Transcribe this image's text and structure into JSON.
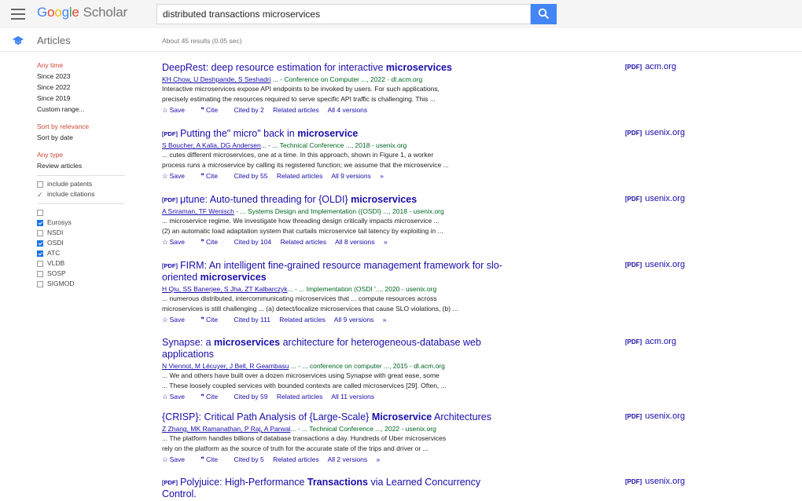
{
  "header": {
    "logo_parts": [
      "G",
      "o",
      "o",
      "g",
      "l",
      "e"
    ],
    "logo_suffix": "Scholar",
    "search_value": "distributed transactions microservices"
  },
  "subheader": {
    "section_label": "Articles",
    "results_count": "About 45 results (0.05 sec)"
  },
  "sidebar": {
    "time_links": [
      "Any time",
      "Since 2023",
      "Since 2022",
      "Since 2019",
      "Custom range..."
    ],
    "sort_links": [
      "Sort by relevance",
      "Sort by date"
    ],
    "type_links": [
      "Any type",
      "Review articles"
    ],
    "include_patents": "include patents",
    "include_citations": "include citations",
    "venues": [
      {
        "label": "",
        "checked": false
      },
      {
        "label": "Eurosys",
        "checked": true
      },
      {
        "label": "NSDI",
        "checked": false
      },
      {
        "label": "OSDI",
        "checked": true
      },
      {
        "label": "ATC",
        "checked": true
      },
      {
        "label": "VLDB",
        "checked": false
      },
      {
        "label": "SOSP",
        "checked": false
      },
      {
        "label": "SIGMOD",
        "checked": false
      }
    ]
  },
  "results": [
    {
      "title_a": "DeepRest: deep resource estimation for interactive ",
      "title_b": "microservices",
      "authors": "KH Chow, U Deshpande, S Seshadri",
      "venue": " ... - Conference on Computer ..., 2022 - dl.acm.org",
      "snippet1": "Interactive microservices expose API endpoints to be invoked by users. For such applications,",
      "snippet2": "precisely estimating the resources required to serve specific API traffic is challenging. This ...",
      "save": "Save",
      "cite": "Cite",
      "cited_by": "Cited by 2",
      "related": "Related articles",
      "versions": "All 4 versions",
      "side_tag": "[PDF]",
      "side_source": "acm.org"
    },
    {
      "pdf": "[PDF]",
      "title_a": "Putting the\" micro\" back in ",
      "title_b": "microservice",
      "authors": "S Boucher, A Kalia, DG Andersen",
      "venue": "... - ... Technical Conference ..., 2018 - usenix.org",
      "snippet1": "... cutes different microservices, one at a time. In this approach, shown in Figure 1, a worker",
      "snippet2": "process runs a microservice by calling its registered function; we assume that the microservice ...",
      "save": "Save",
      "cite": "Cite",
      "cited_by": "Cited by 55",
      "related": "Related articles",
      "versions": "All 9 versions",
      "side_tag": "[PDF]",
      "side_source": "usenix.org"
    },
    {
      "pdf": "[PDF]",
      "title_a": "μtune: Auto-tuned threading for {OLDI} ",
      "title_b": "microservices",
      "authors": "A Sriraman, TF Wenisch",
      "venue": " - ... Systems Design and Implementation ({OSDI} ..., 2018 - usenix.org",
      "snippet1": "... microservice regime. We investigate how threading design critically impacts microservice ...",
      "snippet2": "(2) an automatic load adaptation system that curtails microservice tail latency by exploiting in ...",
      "save": "Save",
      "cite": "Cite",
      "cited_by": "Cited by 104",
      "related": "Related articles",
      "versions": "All 8 versions",
      "side_tag": "[PDF]",
      "side_source": "usenix.org"
    },
    {
      "pdf": "[PDF]",
      "title_a": "FIRM: An intelligent fine-grained resource management framework for slo-",
      "title_b2": "oriented ",
      "title_c": "microservices",
      "authors": "H Qiu, SS Banerjee, S Jha, ZT Kalbarczyk",
      "venue": "... - ... Implementation (OSDI '..., 2020 - usenix.org",
      "snippet1": "... numerous distributed, intercommunicating microservices that ... compute resources across",
      "snippet2": "microservices is still challenging ... (a) detect/localize microservices that cause SLO violations, (b) ...",
      "save": "Save",
      "cite": "Cite",
      "cited_by": "Cited by 111",
      "related": "Related articles",
      "versions": "All 9 versions",
      "side_tag": "[PDF]",
      "side_source": "usenix.org"
    },
    {
      "title_a": "Synapse: a ",
      "title_b": "microservices",
      "title_c": " architecture for heterogeneous-database web",
      "title_d": "applications",
      "authors": "N Viennot, M Lécuyer, J Bell, R Geambasu",
      "venue": " ... - ... conference on computer ..., 2015 - dl.acm.org",
      "snippet1": "... We and others have built over a dozen microservices using Synapse with great ease, some",
      "snippet2": "... These loosely coupled services with bounded contexts are called microservices [29]. Often, ...",
      "save": "Save",
      "cite": "Cite",
      "cited_by": "Cited by 59",
      "related": "Related articles",
      "versions": "All 11 versions",
      "side_tag": "[PDF]",
      "side_source": "acm.org"
    },
    {
      "title_a": "{CRISP}: Critical Path Analysis of {Large-Scale} ",
      "title_b": "Microservice",
      "title_c": " Architectures",
      "authors": "Z Zhang, MK Ramanathan, P Raj, A Parwal",
      "venue": "... - ... Technical Conference ..., 2022 - usenix.org",
      "snippet1": "... The platform handles billions of database transactions a day. Hundreds of Uber microservices",
      "snippet2": "rely on the platform as the source of truth for the accurate state of the trips and driver or ...",
      "save": "Save",
      "cite": "Cite",
      "cited_by": "Cited by 5",
      "related": "Related articles",
      "versions": "All 2 versions",
      "side_tag": "[PDF]",
      "side_source": "usenix.org"
    },
    {
      "pdf": "[PDF]",
      "title_a": "Polyjuice: High-Performance ",
      "title_b": "Transactions",
      "title_c": " via Learned Concurrency",
      "title_d": "Control.",
      "side_tag": "[PDF]",
      "side_source": "usenix.org"
    }
  ]
}
